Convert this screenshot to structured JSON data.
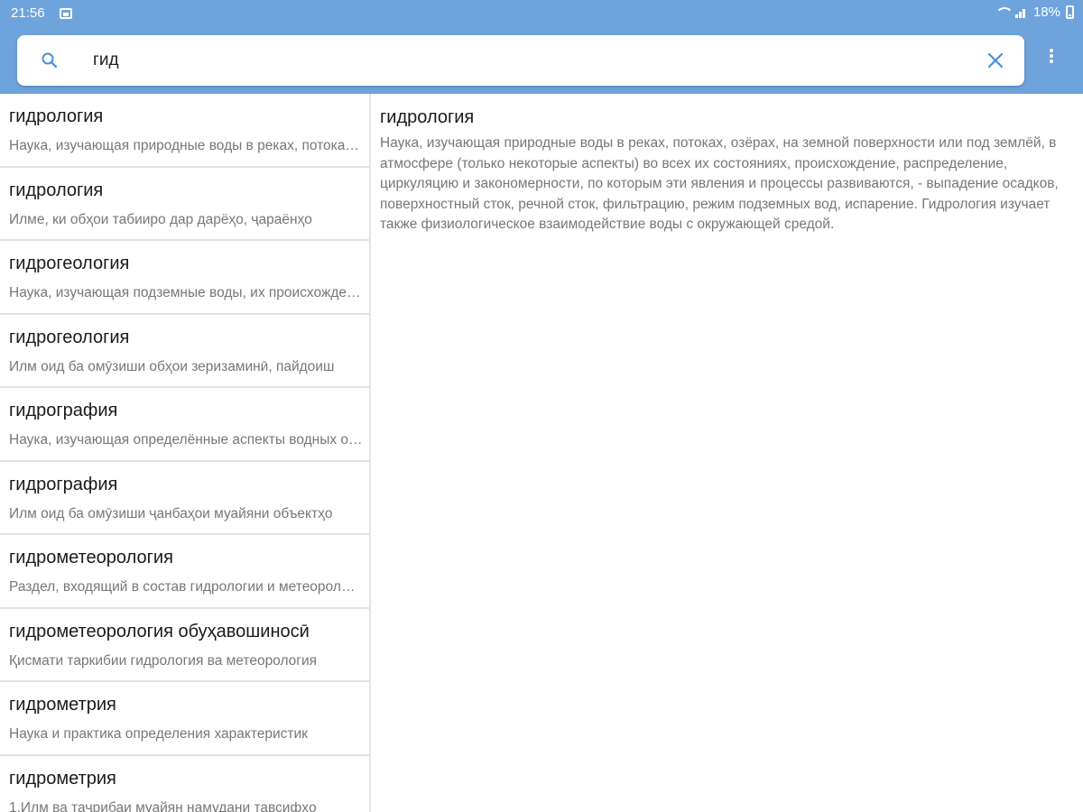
{
  "status": {
    "time": "21:56",
    "battery": "18%",
    "icons": [
      "image-icon",
      "wifi-icon",
      "signal-icon",
      "battery-icon"
    ]
  },
  "search": {
    "value": "гид",
    "placeholder": ""
  },
  "colors": {
    "appbar": "#6fa3dc",
    "accent": "#4a8fd8"
  },
  "results": [
    {
      "title": "гидрология",
      "snippet": "Наука, изучающая природные воды в реках, потоках, озёрах"
    },
    {
      "title": "гидрология",
      "snippet": "Илме, ки обҳои табииро дар дарёҳо, ҷараёнҳо"
    },
    {
      "title": "гидрогеология",
      "snippet": "Наука, изучающая подземные воды, их происхождение"
    },
    {
      "title": "гидрогеология",
      "snippet": "Илм оид ба омӯзиши обҳои зеризаминӣ, пайдоиш"
    },
    {
      "title": "гидрография",
      "snippet": "Наука, изучающая определённые аспекты водных объектов"
    },
    {
      "title": "гидрография",
      "snippet": "Илм оид ба омӯзиши ҷанбаҳои муайяни объектҳо"
    },
    {
      "title": "гидрометеорология",
      "snippet": "Раздел, входящий в состав гидрологии и метеорологии"
    },
    {
      "title": "гидрометеорология обуҳавошиносӣ",
      "snippet": "Қисмати таркибии гидрология ва метеорология"
    },
    {
      "title": "гидрометрия",
      "snippet": "Наука и практика определения характеристик"
    },
    {
      "title": "гидрометрия",
      "snippet": "1.Илм ва таҷрибаи муайян намудани тавсифҳо"
    }
  ],
  "detail": {
    "title": "гидрология",
    "body": "Наука, изучающая природные воды в реках, потоках, озёрах, на земной поверхности или под землёй, в атмосфере (только некоторые аспекты) во всех их состояниях, происхождение, распределение, циркуляцию и закономерности, по которым эти явления и процессы развиваются, - выпадение осадков, поверхностный сток, речной сток, фильтрацию, режим подземных вод, испарение. Гидрология изучает также физиологическое взаимодействие воды с окружающей средой."
  }
}
